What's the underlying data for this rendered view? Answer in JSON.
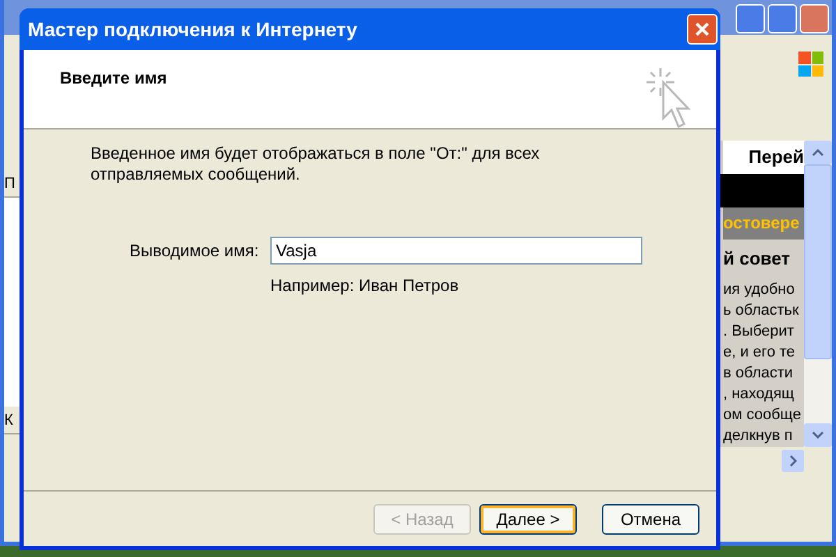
{
  "background_window": {
    "left_pane": {
      "header_top": "П",
      "header_bottom": "К"
    },
    "content_pane": {
      "link": "Перей",
      "banner": "остовере",
      "heading": "й совет",
      "lines": [
        "ия удобно",
        "ь областьк",
        ". Выберит",
        "е, и его те",
        "в области",
        ", находящ",
        "ом сообще",
        "делкнув п"
      ]
    }
  },
  "dialog": {
    "title": "Мастер подключения к Интернету",
    "header": "Введите имя",
    "description": "Введенное имя будет отображаться в поле \"От:\" для всех отправляемых сообщений.",
    "field": {
      "label": "Выводимое имя:",
      "value": "Vasja"
    },
    "example": "Например: Иван Петров",
    "buttons": [
      {
        "label": "< Назад",
        "disabled": true,
        "focused": false
      },
      {
        "label": "Далее >",
        "disabled": false,
        "focused": true
      },
      {
        "label": "Отмена",
        "disabled": false,
        "focused": false
      }
    ]
  }
}
